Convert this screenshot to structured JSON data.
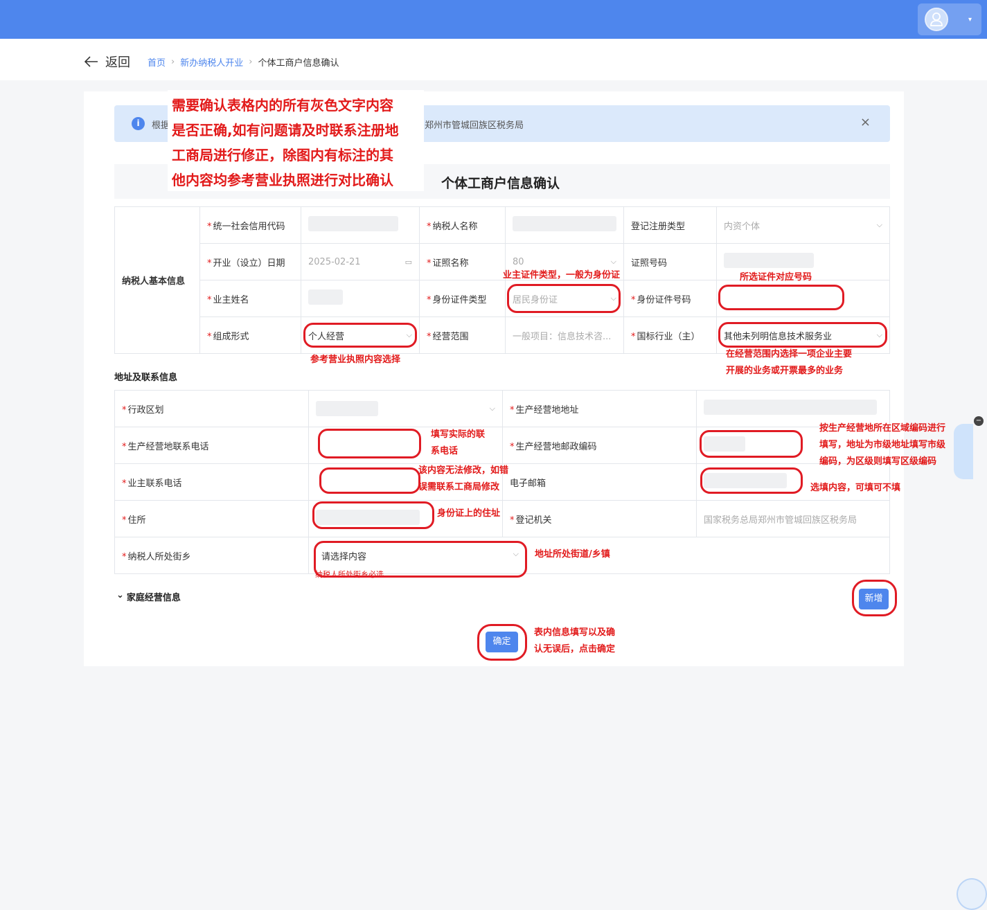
{
  "header": {
    "avatar_icon": "user-avatar-icon",
    "caret": "▾"
  },
  "breadcrumb": {
    "back_label": "返回",
    "items": [
      "首页",
      "新办纳税人开业",
      "个体工商户信息确认"
    ]
  },
  "notice": {
    "text_start": "根据",
    "text_end": "郑州市管城回族区税务局",
    "close": "×"
  },
  "page_title": "个体工商户信息确认",
  "overlay_note": [
    "需要确认表格内的所有灰色文字内容",
    "是否正确,如有问题请及时联系注册地",
    "工商局进行修正，除图内有标注的其",
    "他内容均参考营业执照进行对比确认"
  ],
  "basic_info": {
    "section_label": "纳税人基本信息",
    "credit_code_label": "统一社会信用代码",
    "taxpayer_name_label": "纳税人名称",
    "reg_type_label": "登记注册类型",
    "reg_type_value": "内资个体",
    "open_date_label": "开业（设立）日期",
    "open_date_value": "2025-02-21",
    "license_name_label": "证照名称",
    "license_name_value": "80",
    "license_no_label": "证照号码",
    "owner_name_label": "业主姓名",
    "id_type_label": "身份证件类型",
    "id_type_value": "居民身份证",
    "id_no_label": "身份证件号码",
    "org_form_label": "组成形式",
    "org_form_value": "个人经营",
    "scope_label": "经营范围",
    "scope_value": "一般项目：信息技术咨...",
    "industry_label": "国标行业（主）",
    "industry_value": "其他未列明信息技术服务业"
  },
  "address": {
    "section_label": "地址及联系信息",
    "region_label": "行政区划",
    "biz_address_label": "生产经营地地址",
    "biz_phone_label": "生产经营地联系电话",
    "postcode_label": "生产经营地邮政编码",
    "owner_phone_label": "业主联系电话",
    "email_label": "电子邮箱",
    "residence_label": "住所",
    "reg_authority_label": "登记机关",
    "reg_authority_value": "国家税务总局郑州市管城回族区税务局",
    "street_label": "纳税人所处街乡",
    "street_placeholder": "请选择内容",
    "street_error": "纳税人所处街乡必选"
  },
  "family": {
    "section_label": "家庭经营信息",
    "add_button": "新增"
  },
  "confirm_button": "确定",
  "annotations": {
    "id_type": "业主证件类型，一般为身份证",
    "id_no": "所选证件对应号码",
    "org_form": "参考营业执照内容选择",
    "industry": [
      "在经营范围内选择一项企业主要",
      "开展的业务或开票最多的业务"
    ],
    "biz_phone": [
      "填写实际的联",
      "系电话"
    ],
    "postcode": [
      "按生产经营地所在区域编码进行",
      "填写，地址为市级地址填写市级",
      "编码，为区级则填写区级编码"
    ],
    "owner_phone": [
      "该内容无法修改，如错",
      "误需联系工商局修改"
    ],
    "email": "选填内容，可填可不填",
    "residence": "身份证上的住址",
    "street": "地址所处街道/乡镇",
    "confirm": [
      "表内信息填写以及确",
      "认无误后，点击确定"
    ]
  }
}
